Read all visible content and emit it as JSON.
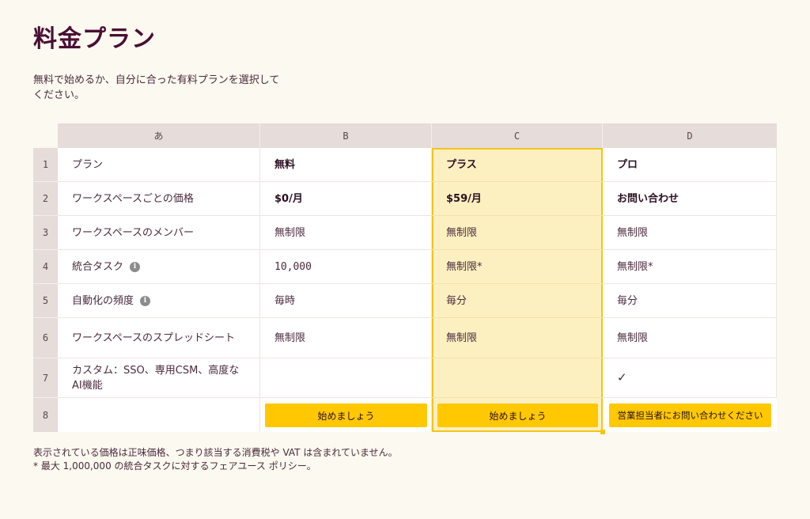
{
  "page": {
    "title": "料金プラン",
    "subtitle": "無料で始めるか、自分に合った有料プランを選択してください。"
  },
  "sheet": {
    "column_headers": [
      "あ",
      "B",
      "C",
      "D"
    ],
    "row_headers": [
      "1",
      "2",
      "3",
      "4",
      "5",
      "6",
      "7",
      "8"
    ],
    "rows": [
      {
        "label": "プラン",
        "b": "無料",
        "c": "プラス",
        "d": "プロ"
      },
      {
        "label": "ワークスペースごとの価格",
        "b": "$0/月",
        "c": "$59/月",
        "d": "お問い合わせ"
      },
      {
        "label": "ワークスペースのメンバー",
        "b": "無制限",
        "c": "無制限",
        "d": "無制限"
      },
      {
        "label": "統合タスク",
        "b": "10,000",
        "c": "無制限*",
        "d": "無制限*"
      },
      {
        "label": "自動化の頻度",
        "b": "毎時",
        "c": "毎分",
        "d": "毎分"
      },
      {
        "label": "ワークスペースのスプレッドシート",
        "b": "無制限",
        "c": "無制限",
        "d": "無制限"
      },
      {
        "label": "カスタム：SSO、専用CSM、高度なAI機能",
        "b": "",
        "c": "",
        "d": "✓"
      }
    ],
    "info_icon_glyph": "i",
    "buttons": {
      "b": "始めましょう",
      "c": "始めましょう",
      "d": "営業担当者にお問い合わせください"
    }
  },
  "footnotes": [
    "表示されている価格は正味価格、つまり該当する消費税や VAT は含まれていません。",
    "* 最大 1,000,000 の統合タスクに対するフェアユース ポリシー。"
  ],
  "colors": {
    "background": "#fcf9f0",
    "title": "#4a0e33",
    "highlight_fill": "#fdf0c0",
    "highlight_border": "#f5c518",
    "button": "#ffc800",
    "header_fill": "#e6dcd9"
  }
}
